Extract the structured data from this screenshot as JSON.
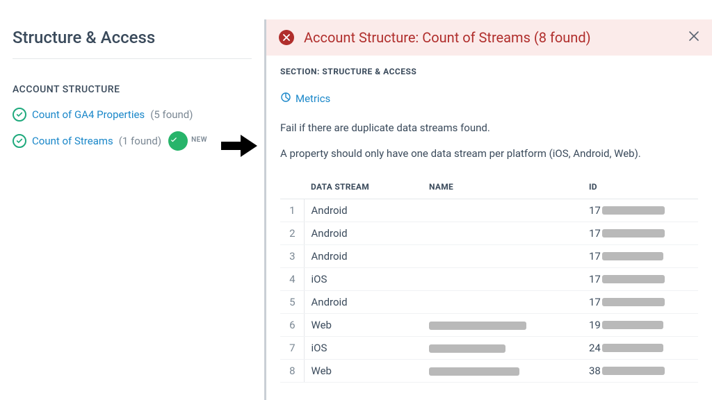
{
  "left": {
    "title": "Structure & Access",
    "section": "ACCOUNT STRUCTURE",
    "items": [
      {
        "label": "Count of GA4 Properties",
        "found": "(5 found)",
        "new": false
      },
      {
        "label": "Count of Streams",
        "found": "(1 found)",
        "new": true
      }
    ],
    "new_badge": "NEW"
  },
  "alert": {
    "title": "Account Structure: Count of Streams (8 found)"
  },
  "body": {
    "section_label": "SECTION: STRUCTURE & ACCESS",
    "metrics_label": "Metrics",
    "desc1": "Fail if there are duplicate data streams found.",
    "desc2": "A property should only have one data stream per platform (iOS, Android, Web)."
  },
  "table": {
    "headers": {
      "ds": "DATA STREAM",
      "name": "NAME",
      "id": "ID"
    },
    "rows": [
      {
        "n": "1",
        "ds": "Android",
        "name_redact_w": 0,
        "id_prefix": "17",
        "id_redact_w": 90
      },
      {
        "n": "2",
        "ds": "Android",
        "name_redact_w": 0,
        "id_prefix": "17",
        "id_redact_w": 90
      },
      {
        "n": "3",
        "ds": "Android",
        "name_redact_w": 0,
        "id_prefix": "17",
        "id_redact_w": 88
      },
      {
        "n": "4",
        "ds": "iOS",
        "name_redact_w": 0,
        "id_prefix": "17",
        "id_redact_w": 90
      },
      {
        "n": "5",
        "ds": "Android",
        "name_redact_w": 0,
        "id_prefix": "17",
        "id_redact_w": 90
      },
      {
        "n": "6",
        "ds": "Web",
        "name_redact_w": 140,
        "id_prefix": "19",
        "id_redact_w": 88
      },
      {
        "n": "7",
        "ds": "iOS",
        "name_redact_w": 110,
        "id_prefix": "24",
        "id_redact_w": 88
      },
      {
        "n": "8",
        "ds": "Web",
        "name_redact_w": 130,
        "id_prefix": "38",
        "id_redact_w": 90
      }
    ]
  }
}
